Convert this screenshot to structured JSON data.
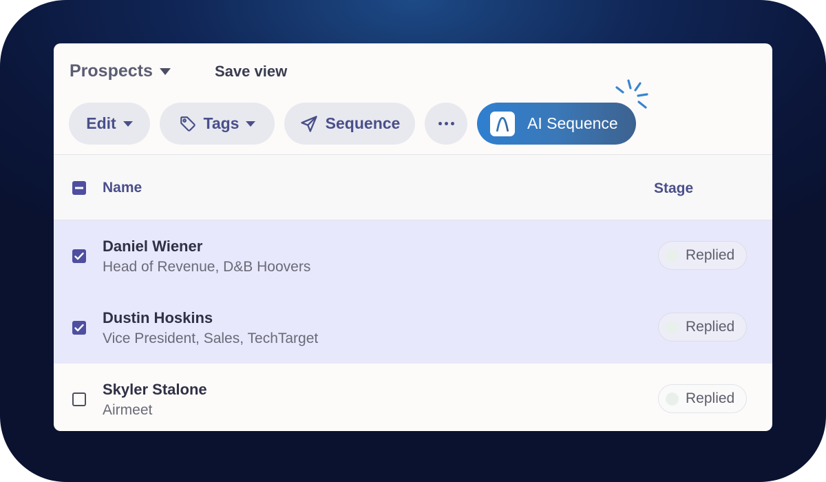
{
  "header": {
    "view_title": "Prospects",
    "save_view": "Save view"
  },
  "toolbar": {
    "edit": "Edit",
    "tags": "Tags",
    "sequence": "Sequence",
    "ai_sequence": "AI Sequence"
  },
  "table": {
    "columns": {
      "name": "Name",
      "stage": "Stage"
    },
    "rows": [
      {
        "name": "Daniel Wiener",
        "subtitle": "Head of Revenue, D&B Hoovers",
        "stage": "Replied",
        "selected": true
      },
      {
        "name": "Dustin Hoskins",
        "subtitle": "Vice President, Sales, TechTarget",
        "stage": "Replied",
        "selected": true
      },
      {
        "name": "Skyler Stalone",
        "subtitle": "Airmeet",
        "stage": "Replied",
        "selected": false
      }
    ]
  },
  "colors": {
    "accent": "#4a4f8a",
    "selected_row": "#e7e8fb",
    "ai_gradient_start": "#2f7fd0",
    "ai_gradient_end": "#3d628f"
  },
  "icons": {
    "view_dropdown": "caret-down-icon",
    "tags": "tag-icon",
    "sequence": "send-icon",
    "more": "more-dots-icon",
    "ai": "ai-logo-icon",
    "sparkle": "sparkle-icon"
  }
}
